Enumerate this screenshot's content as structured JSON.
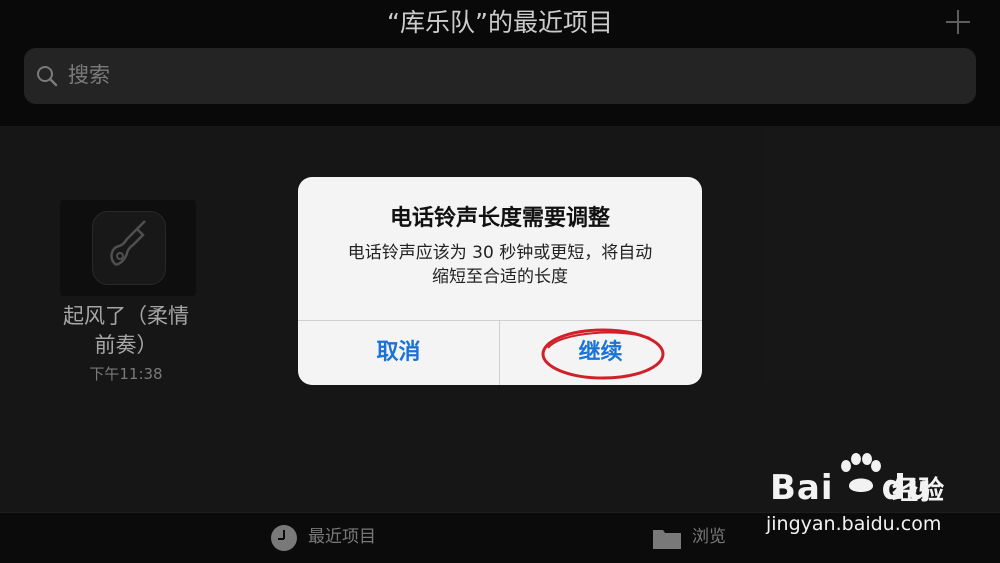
{
  "header": {
    "title": "“库乐队”的最近项目",
    "add_icon": "plus-icon"
  },
  "search": {
    "placeholder": "搜索",
    "icon": "search-icon"
  },
  "projects": [
    {
      "name": "起风了（柔情前奏）",
      "name_line1": "起风了（柔情",
      "name_line2": "前奏）",
      "time": "下午11:38",
      "icon": "guitar-icon"
    }
  ],
  "dialog": {
    "title": "电话铃声长度需要调整",
    "message_line1": "电话铃声应该为 30 秒钟或更短，将自动",
    "message_line2": "缩短至合适的长度",
    "cancel_label": "取消",
    "continue_label": "继续",
    "accent_color": "#1a73d8",
    "highlight_color": "#d0202a"
  },
  "tabbar": {
    "recent_label": "最近项目",
    "browse_label": "浏览"
  },
  "watermark": {
    "brand": "Bai",
    "brand2": "du",
    "cn": "经验",
    "url": "jingyan.baidu.com"
  }
}
